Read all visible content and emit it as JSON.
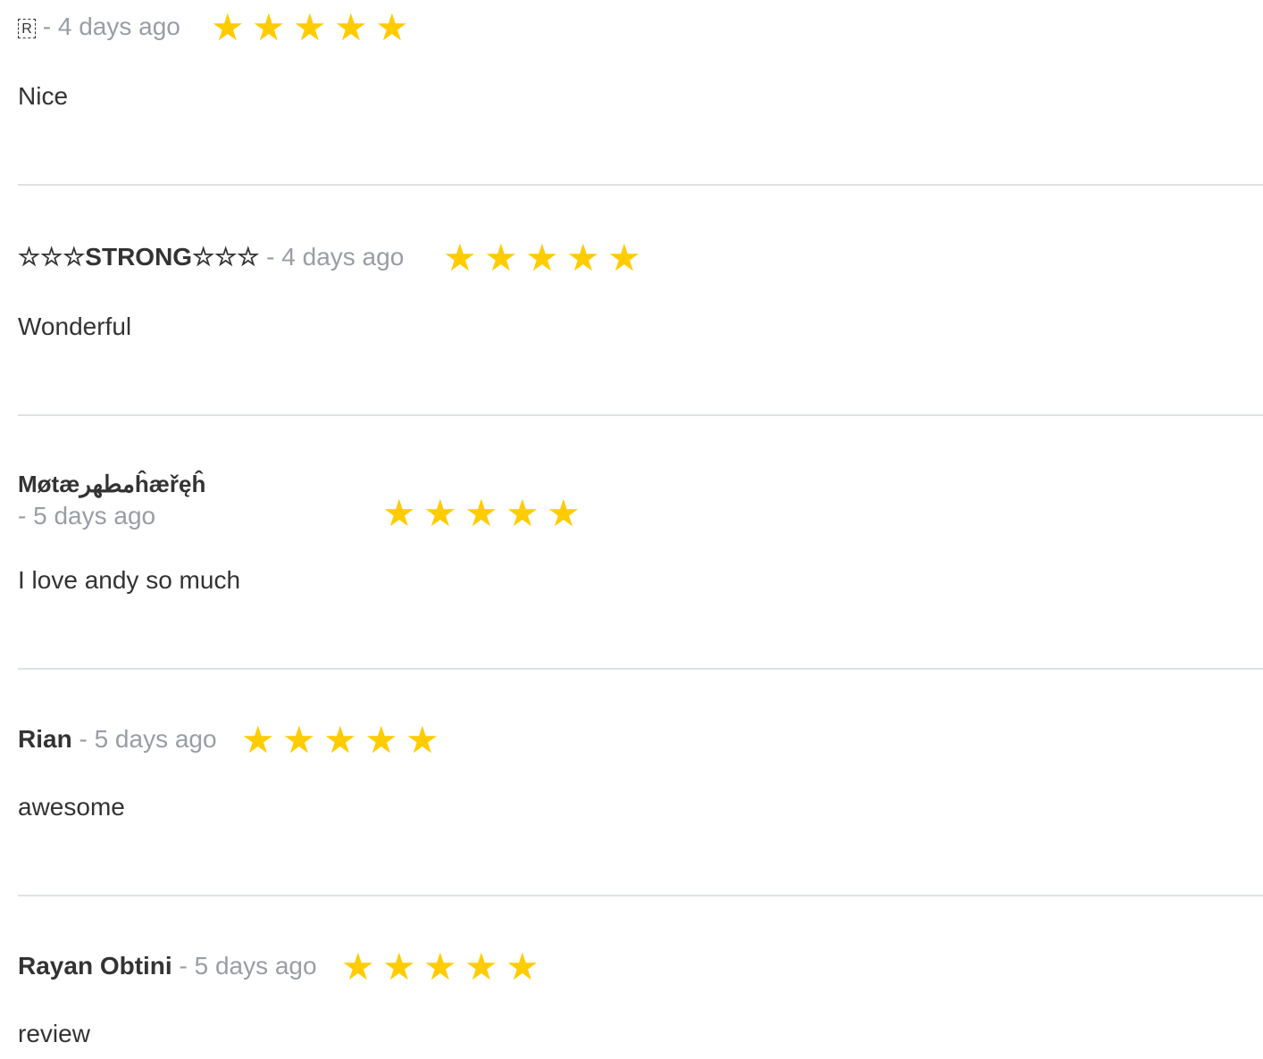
{
  "reviews": [
    {
      "author": "R",
      "author_is_glyph": true,
      "time": "- 4 days ago",
      "rating": 5,
      "body": "Nice"
    },
    {
      "author": "☆☆☆STRONG☆☆☆",
      "time": "- 4 days ago",
      "rating": 5,
      "body": "Wonderful"
    },
    {
      "author": "Møtæ‫مطهر‬ĥæřęĥ",
      "time": "- 5 days ago",
      "rating": 5,
      "body": "I love andy so much"
    },
    {
      "author": "Rian",
      "time": "- 5 days ago",
      "rating": 5,
      "body": "awesome"
    },
    {
      "author": "Rayan Obtini",
      "time": "- 5 days ago",
      "rating": 5,
      "body": "review"
    }
  ],
  "star_glyph": "★",
  "colors": {
    "star": "#ffcc00",
    "text": "#333333",
    "muted": "#999ea4",
    "divider": "#dfe2e5"
  }
}
